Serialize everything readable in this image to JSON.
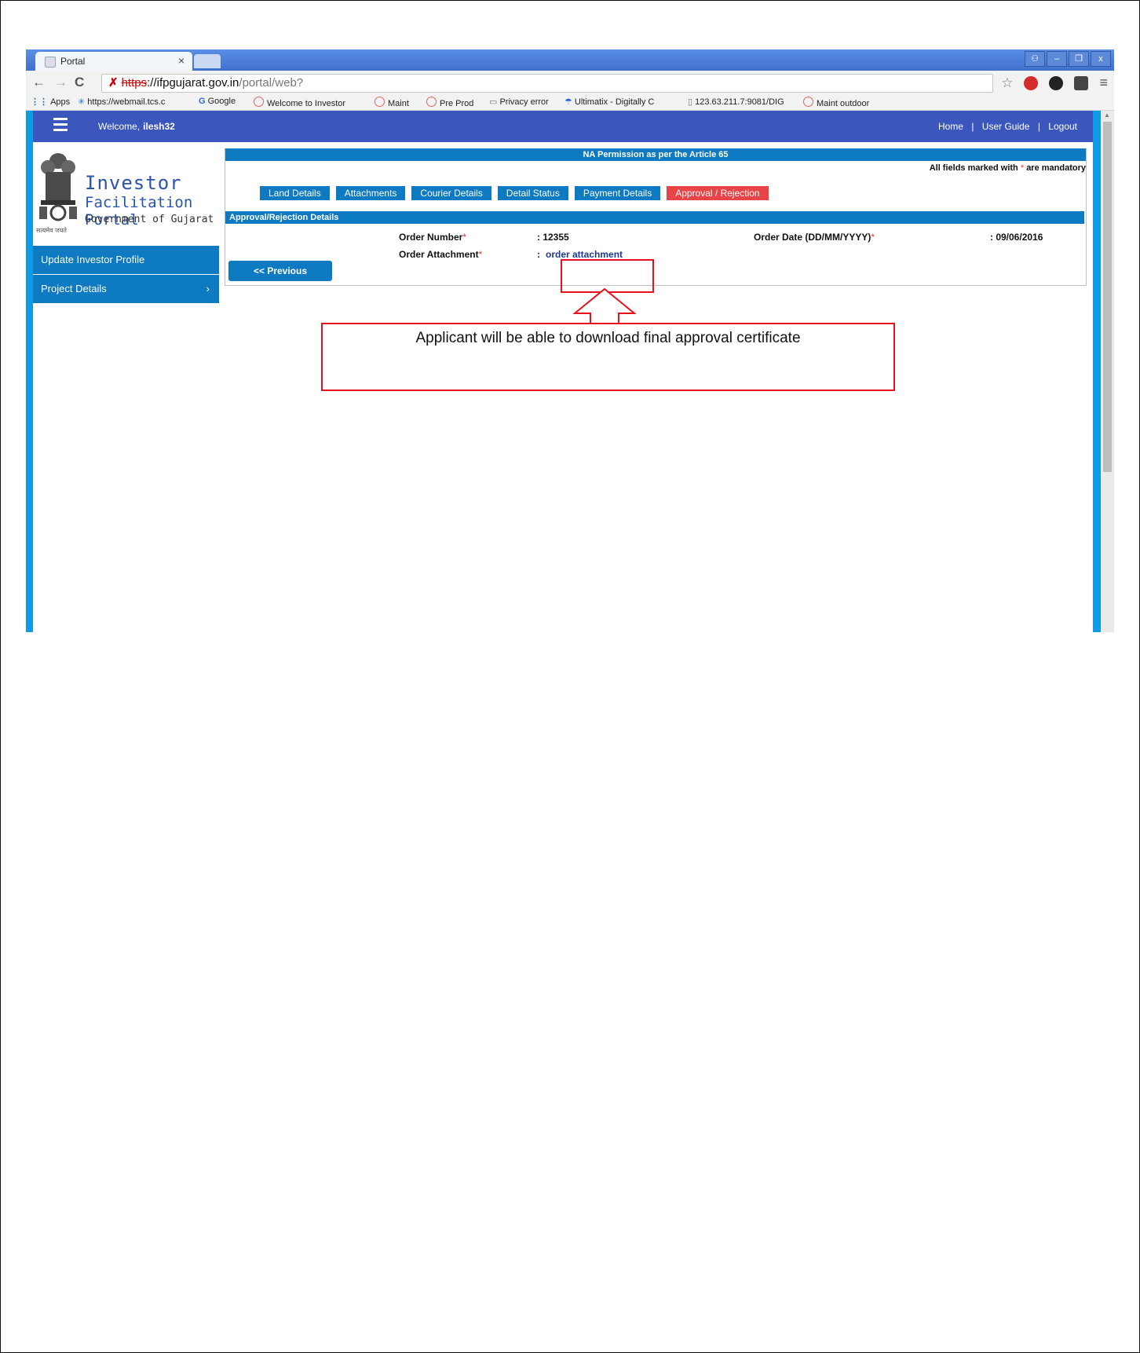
{
  "browser": {
    "tab_title": "Portal",
    "tab_close": "×",
    "url_https": "https",
    "url_host": "://ifpgujarat.gov.in",
    "url_path": "/portal/web?",
    "window_buttons": [
      "⚇",
      "–",
      "❐",
      "x"
    ],
    "nav": {
      "back": "←",
      "forward": "→",
      "reload": "C"
    },
    "bookmarks": [
      "Apps",
      "https://webmail.tcs.c",
      "Google",
      "Welcome to Investor",
      "Maint",
      "Pre Prod",
      "Privacy error",
      "Ultimatix - Digitally C",
      "123.63.211.7:9081/DIG",
      "Maint outdoor"
    ],
    "menu_icon": "≡",
    "star_icon": "☆"
  },
  "header": {
    "welcome_label": "Welcome,",
    "username": "ilesh32",
    "links": [
      "Home",
      "User Guide",
      "Logout"
    ],
    "separator": "|"
  },
  "logo": {
    "line1": "Investor",
    "line2": "Facilitation Portal",
    "line3": "Government of Gujarat",
    "motto": "सत्यमेव जयते"
  },
  "sidebar": {
    "items": [
      {
        "label": "Update Investor Profile"
      },
      {
        "label": "Project Details",
        "arrow": "›"
      }
    ]
  },
  "form": {
    "title": "NA Permission as per the Article 65",
    "mandatory_prefix": "All fields marked with",
    "mandatory_star": "*",
    "mandatory_suffix": "are mandatory",
    "tabs": [
      "Land Details",
      "Attachments",
      "Courier Details",
      "Detail Status",
      "Payment Details",
      "Approval / Rejection"
    ],
    "active_tab": "Approval / Rejection",
    "section_title": "Approval/Rejection Details",
    "order_number_label": "Order Number",
    "order_number_value": ": 12355",
    "order_date_label": "Order Date (DD/MM/YYYY)",
    "order_date_value": ": 09/06/2016",
    "order_attachment_label": "Order Attachment",
    "order_attachment_colon": ":",
    "order_attachment_link": "order attachment",
    "required_star": "*",
    "previous_button": "<< Previous"
  },
  "annotation": {
    "callout_text": "Applicant will be able to download final approval certificate"
  },
  "colors": {
    "header_blue": "#3b57bd",
    "portal_blue": "#0d7ac1",
    "active_tab_red": "#e84347",
    "annotation_red": "#e8101c"
  }
}
